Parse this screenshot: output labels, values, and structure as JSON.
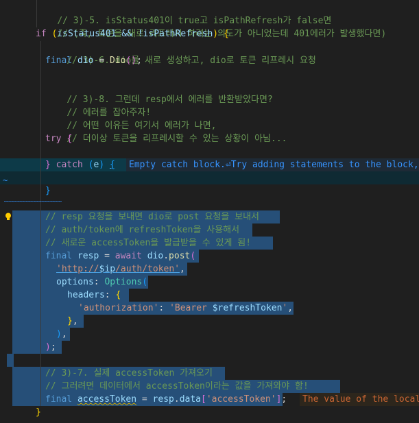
{
  "editor": {
    "language": "dart",
    "lines": {
      "l1": "// 3)-5. isStatus401이 true고 isPathRefresh가 false면",
      "l2": "// (즉, 토큰을 새로 리프레시 하려는 의도가 아니었는데 401에러가 발생했다면)",
      "l3_kw": "if",
      "l3_body": "isStatus401 && !isPathRefresh",
      "l4": "// 3)-6. dio를 새로 생성하고, dio로 토큰 리프레시 요청",
      "l5_kw": "final",
      "l5_var": "dio",
      "l5_fn": "Dio",
      "l7": "// 3)-8. 그런데 resp에서 에러를 반환받았다면?",
      "l8": "// 에러를 잡아주자!",
      "l9": "// 어떤 이유든 여기서 에러가 나면,",
      "l10": "// 더이상 토큰을 리프레시할 수 있는 상황이 아님...",
      "l11_kw": "try",
      "l13_kw": "catch",
      "l13_var": "e",
      "l17": "// resp 요청을 보내면 dio로 post 요청을 보내서",
      "l18": "// auth/token에 refreshToken을 사용해서",
      "l19": "// 새로운 accessToken을 발급받을 수 있게 됨!",
      "l20_kw": "final",
      "l20_var": "resp",
      "l20_await": "await",
      "l20_obj": "dio",
      "l20_fn": "post",
      "l21_str1": "'http://",
      "l21_interp": "$ip",
      "l21_str2": "/auth/token'",
      "l22_param": "options",
      "l22_cls": "Options",
      "l23_param": "headers",
      "l24_key": "'authorization'",
      "l24_val1": "'Bearer ",
      "l24_interp": "$refreshToken",
      "l24_val2": "'",
      "l28": "// 3)-7. 실제 accessToken 가져오기",
      "l29": "// 그러려면 데이터에서 accessToken이라는 값을 가져와야 함!",
      "l30_kw": "final",
      "l30_var": "accessToken",
      "l30_obj": "resp",
      "l30_prop": "data",
      "l30_key": "'accessToken'"
    },
    "hints": {
      "catch_info": "Empty catch block.⏎Try adding statements to the block,",
      "access_warn": "The value of the local"
    }
  }
}
